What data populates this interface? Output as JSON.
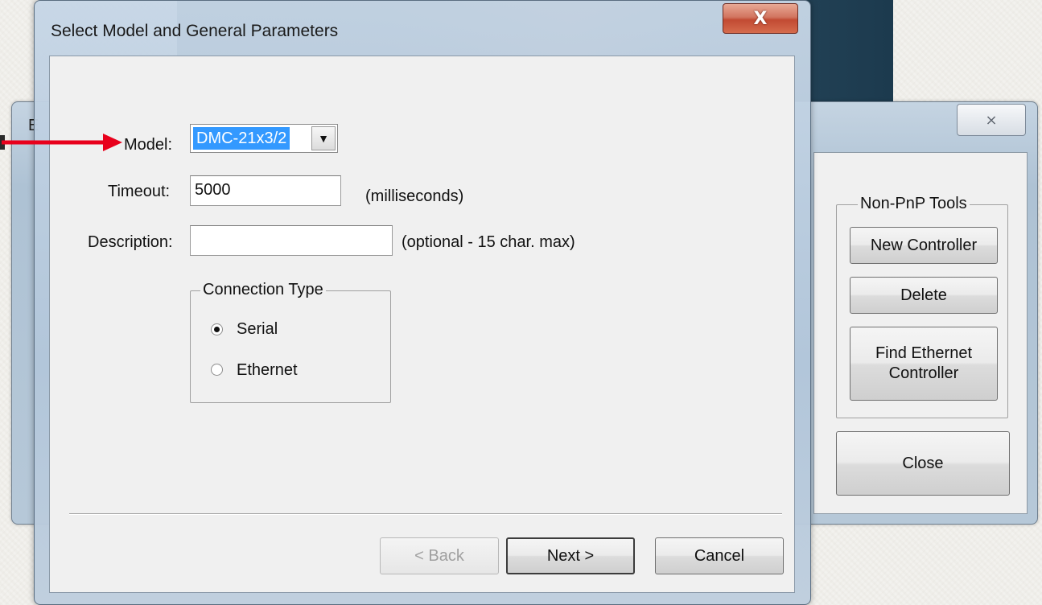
{
  "background_window": {
    "title_fragment": "E",
    "close_glyph": "⨯",
    "tools_group_title": "Non-PnP Tools",
    "new_controller_label": "New Controller",
    "delete_label": "Delete",
    "find_ethernet_label": "Find Ethernet\nController",
    "close_label": "Close"
  },
  "dialog": {
    "title": "Select Model and General Parameters",
    "close_glyph": "X",
    "model_label": "Model:",
    "model_value": "DMC-21x3/2",
    "timeout_label": "Timeout:",
    "timeout_value": "5000",
    "timeout_hint": "(milliseconds)",
    "description_label": "Description:",
    "description_value": "",
    "description_hint": "(optional - 15 char. max)",
    "connection_group_title": "Connection Type",
    "connection_options": [
      {
        "label": "Serial",
        "selected": true
      },
      {
        "label": "Ethernet",
        "selected": false
      }
    ],
    "back_label": "< Back",
    "next_label": "Next >",
    "cancel_label": "Cancel"
  },
  "annotation": {
    "arrow_color": "#e8001c"
  }
}
